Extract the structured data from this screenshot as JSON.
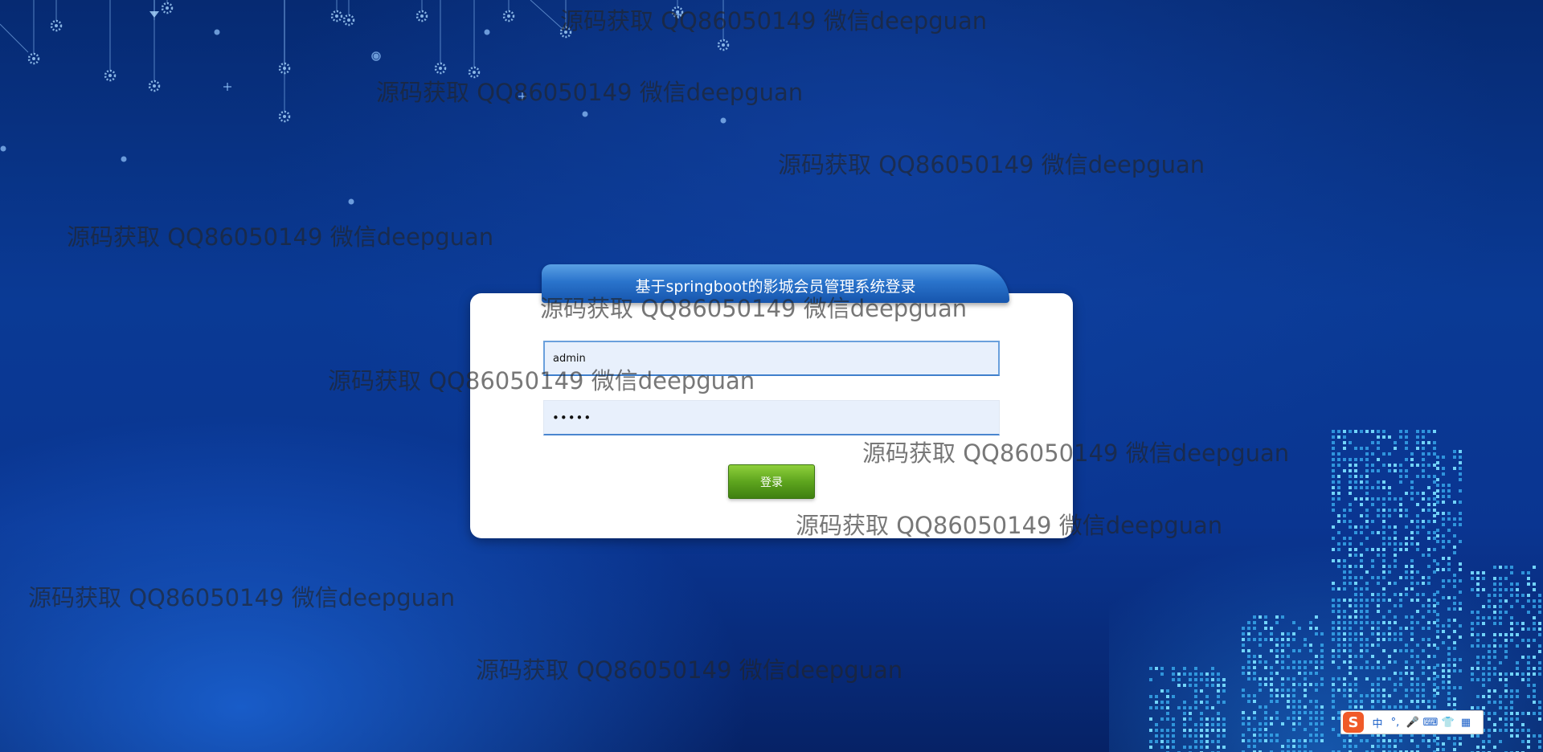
{
  "page": {
    "login_title": "基于springboot的影城会员管理系统登录",
    "username": {
      "value": "admin",
      "placeholder": ""
    },
    "password": {
      "value": "•••••",
      "placeholder": ""
    },
    "login_button_label": "登录"
  },
  "watermark_text": "源码获取 QQ86050149 微信deepguan",
  "ime_toolbar": {
    "logo": "S",
    "items": [
      {
        "icon": "chinese-mode-icon",
        "label": "中"
      },
      {
        "icon": "punctuation-icon",
        "label": "°,"
      },
      {
        "icon": "microphone-icon",
        "label": "🎤"
      },
      {
        "icon": "keyboard-icon",
        "label": "⌨"
      },
      {
        "icon": "skin-icon",
        "label": "👕"
      },
      {
        "icon": "toolbox-icon",
        "label": "▦"
      }
    ]
  },
  "colors": {
    "background": "#0a3a95",
    "header_blue": "#2a74cc",
    "button_green": "#5ea51e",
    "input_bg": "#e8f0fc",
    "city_cyan": "#3ec8ff",
    "ime_logo": "#f05a28"
  }
}
